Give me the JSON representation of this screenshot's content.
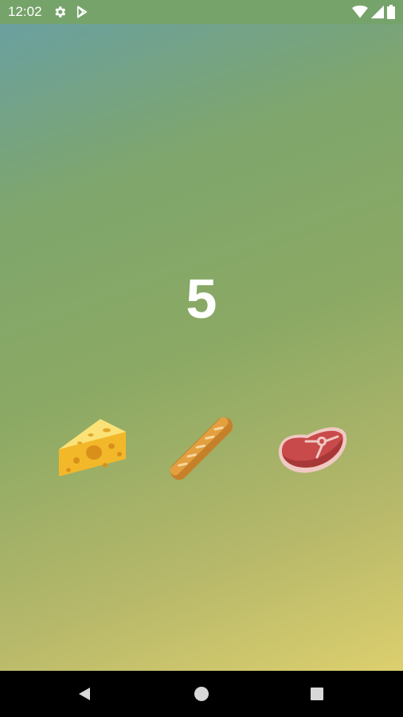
{
  "status_bar": {
    "time": "12:02",
    "icons": [
      "gear-icon",
      "play-store-icon",
      "wifi-icon",
      "signal-icon",
      "battery-icon"
    ]
  },
  "game": {
    "counter": "5",
    "items": [
      "cheese-icon",
      "baguette-icon",
      "steak-icon"
    ]
  },
  "nav_bar": {
    "buttons": [
      "back-icon",
      "home-icon",
      "recents-icon"
    ]
  },
  "colors": {
    "status_bar": "#76a36a",
    "gradient_start": "#6aa0a0",
    "gradient_end": "#dccf6e",
    "counter_text": "#ffffff",
    "nav_bar": "#000000"
  }
}
